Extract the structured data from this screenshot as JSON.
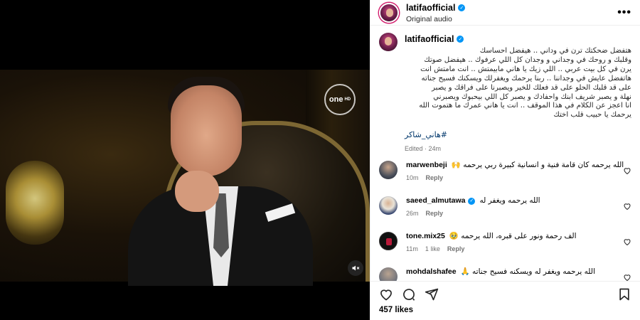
{
  "header": {
    "username": "latifaofficial",
    "audio": "Original audio"
  },
  "video": {
    "channel_logo": "one",
    "channel_logo_sub": "HD"
  },
  "caption": {
    "username": "latifaofficial",
    "lines": [
      "هتفضل ضحكتك ترن في وداني .. هيفضل احساسك",
      "وقلبك و روحك في وجداني و وجدان كل اللي عرفوك .. هيفضل صوتك",
      "يرن في كل بيت عربي .. اللي زيك يا هاني مابيمتش .. انت مامتش انت",
      "هاتفضل عايش في وجداننا .. ربنا يرحمك ويغفرلك ويسكنك فسيح جناته",
      "على قد قلبك الحلو على قد فعلك للخير ويصبرنا على فراقك و يصبر",
      "نهلة و يصبر شريف ابنك واحفادك و يصبر كل اللي بيحبوك ويصبرني",
      "انا اعجز عن الكلام في هذا الموقف .. انت يا هاني عمرك ما هتموت الله",
      "يرحمك يا حبيب قلب اختك"
    ],
    "hashtag": "#هاني_شاكر",
    "edited": "Edited · 24m"
  },
  "comments": [
    {
      "user": "marwenbeji",
      "text": "الله يرحمه كان قامة فنية و انسانية كبيرة ربي يرحمه 🙌",
      "time": "10m",
      "likes": "",
      "reply": "Reply",
      "verified": false
    },
    {
      "user": "saeed_almutawa",
      "text": "الله يرحمه ويغفر له",
      "time": "26m",
      "likes": "",
      "reply": "Reply",
      "verified": true
    },
    {
      "user": "tone.mix25",
      "text": "الف رحمة ونور على قبره، الله يرحمه 🥹",
      "time": "11m",
      "likes": "1 like",
      "reply": "Reply",
      "verified": false
    },
    {
      "user": "mohdalshafee",
      "text": "الله يرحمه ويغفر له ويسكنه فسيح جناته 🙏",
      "time": "",
      "likes": "",
      "reply": "",
      "verified": false
    }
  ],
  "footer": {
    "likes": "457 likes"
  },
  "colors": {
    "verified": "#0095f6",
    "hashtag": "#00376b",
    "secondary_text": "#737373",
    "ring": "#d3206f"
  },
  "icons": [
    "more-icon",
    "verified-icon",
    "heart-icon",
    "comment-icon",
    "share-icon",
    "save-icon",
    "mute-icon"
  ]
}
